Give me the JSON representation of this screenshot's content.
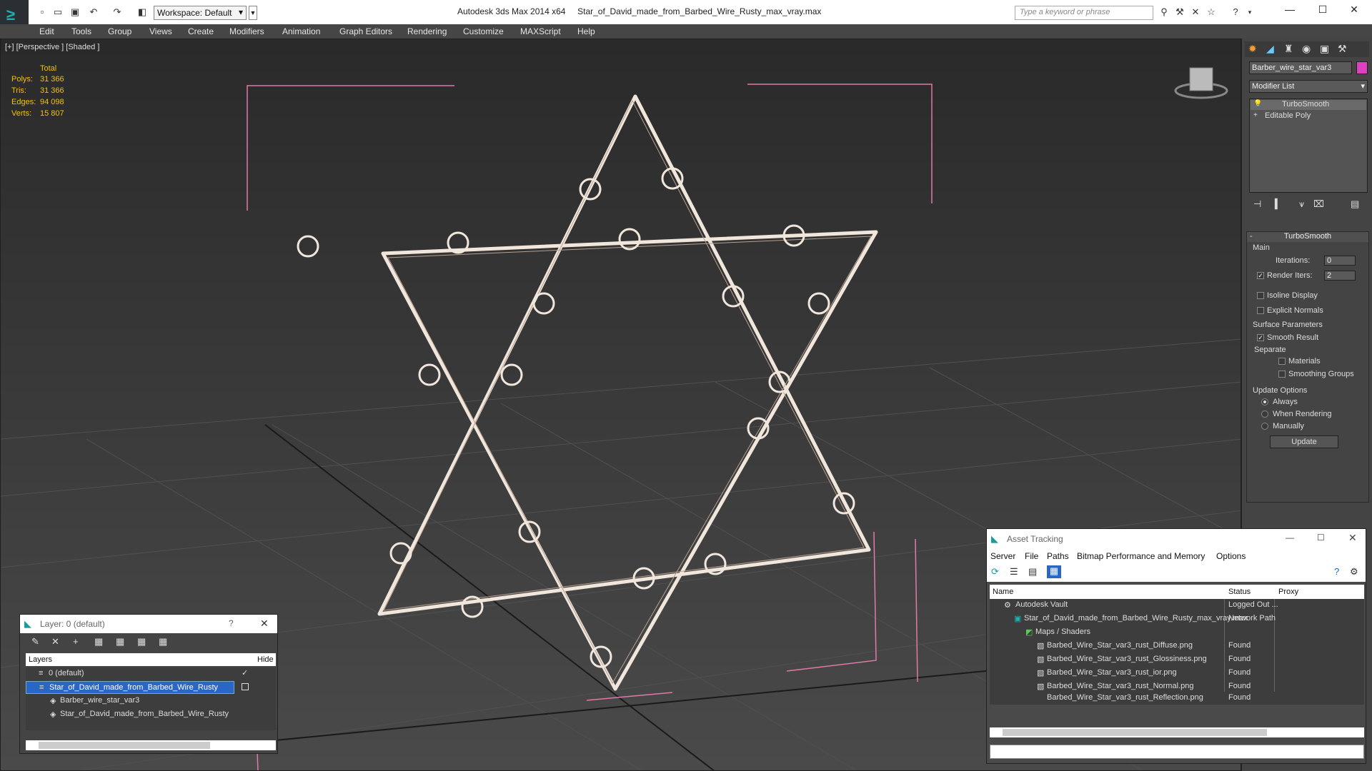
{
  "app": {
    "title": "Autodesk 3ds Max  2014 x64",
    "file": "Star_of_David_made_from_Barbed_Wire_Rusty_max_vray.max",
    "workspace": "Workspace: Default",
    "search_placeholder": "Type a keyword or phrase"
  },
  "menu": [
    "Edit",
    "Tools",
    "Group",
    "Views",
    "Create",
    "Modifiers",
    "Animation",
    "Graph Editors",
    "Rendering",
    "Customize",
    "MAXScript",
    "Help"
  ],
  "viewport": {
    "label": "[+] [Perspective ] [Shaded ]",
    "stats_header": "Total",
    "stats": [
      {
        "label": "Polys:",
        "value": "31 366"
      },
      {
        "label": "Tris:",
        "value": "31 366"
      },
      {
        "label": "Edges:",
        "value": "94 098"
      },
      {
        "label": "Verts:",
        "value": "15 807"
      }
    ]
  },
  "command_panel": {
    "object_name": "Barber_wire_star_var3",
    "modifier_list": "Modifier List",
    "stack": [
      "TurboSmooth",
      "Editable Poly"
    ],
    "rollout_title": "TurboSmooth",
    "main_group": "Main",
    "iterations_label": "Iterations:",
    "iterations_value": "0",
    "render_iters_label": "Render Iters:",
    "render_iters_value": "2",
    "isoline_label": "Isoline Display",
    "explicit_normals_label": "Explicit Normals",
    "surface_group": "Surface Parameters",
    "smooth_result_label": "Smooth Result",
    "separate_label": "Separate",
    "materials_label": "Materials",
    "smoothing_groups_label": "Smoothing Groups",
    "update_group": "Update Options",
    "update_always": "Always",
    "update_when_rendering": "When Rendering",
    "update_manually": "Manually",
    "update_button": "Update",
    "accent_color": "#e040c0"
  },
  "layer_window": {
    "title": "Layer: 0 (default)",
    "help": "?",
    "col_layers": "Layers",
    "col_hide": "Hide",
    "rows": [
      {
        "name": "0 (default)",
        "indent": 0
      },
      {
        "name": "Star_of_David_made_from_Barbed_Wire_Rusty",
        "indent": 0
      },
      {
        "name": "Barber_wire_star_var3",
        "indent": 1
      },
      {
        "name": "Star_of_David_made_from_Barbed_Wire_Rusty",
        "indent": 1
      }
    ]
  },
  "asset_window": {
    "title": "Asset Tracking",
    "menu": [
      "Server",
      "File",
      "Paths",
      "Bitmap Performance and Memory",
      "Options"
    ],
    "col_name": "Name",
    "col_status": "Status",
    "col_proxy": "Proxy",
    "rows": [
      {
        "name": "Autodesk Vault",
        "status": "Logged Out ...",
        "indent": 1
      },
      {
        "name": "Star_of_David_made_from_Barbed_Wire_Rusty_max_vray.max",
        "status": "Network Path",
        "indent": 2
      },
      {
        "name": "Maps / Shaders",
        "status": "",
        "indent": 3
      },
      {
        "name": "Barbed_Wire_Star_var3_rust_Diffuse.png",
        "status": "Found",
        "indent": 4
      },
      {
        "name": "Barbed_Wire_Star_var3_rust_Glossiness.png",
        "status": "Found",
        "indent": 4
      },
      {
        "name": "Barbed_Wire_Star_var3_rust_ior.png",
        "status": "Found",
        "indent": 4
      },
      {
        "name": "Barbed_Wire_Star_var3_rust_Normal.png",
        "status": "Found",
        "indent": 4
      },
      {
        "name": "Barbed_Wire_Star_var3_rust_Reflection.png",
        "status": "Found",
        "indent": 4
      }
    ]
  }
}
